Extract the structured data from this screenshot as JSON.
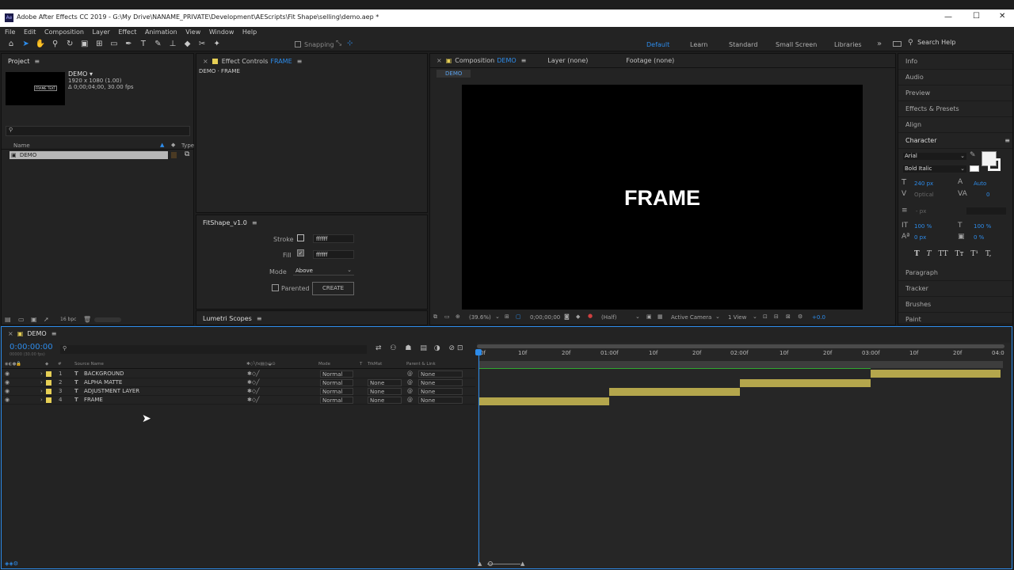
{
  "window": {
    "title": "Adobe After Effects CC 2019 - G:\\My Drive\\NANAME_PRIVATE\\Development\\AEScripts\\Fit Shape\\selling\\demo.aep *",
    "min": "—",
    "max": "☐",
    "close": "✕"
  },
  "menu": [
    "File",
    "Edit",
    "Composition",
    "Layer",
    "Effect",
    "Animation",
    "View",
    "Window",
    "Help"
  ],
  "toolbar": {
    "snapping": "Snapping",
    "workspaces": [
      "Default",
      "Learn",
      "Standard",
      "Small Screen",
      "Libraries"
    ],
    "more": "»",
    "search_placeholder": "Search Help"
  },
  "project": {
    "title": "Project",
    "item_name": "DEMO ▾",
    "item_info1": "1920 x 1080 (1.00)",
    "item_info2": "Δ 0;00;04;00, 30.00 fps",
    "thumb_text": "FRAME TEXT",
    "col_name": "Name",
    "col_type": "Type",
    "row_name": "DEMO",
    "bpc": "16 bpc"
  },
  "effect_controls": {
    "tab": "Effect Controls",
    "tab_target": "FRAME",
    "subtitle": "DEMO · FRAME"
  },
  "fitshape": {
    "title": "FitShape_v1.0",
    "stroke_label": "Stroke",
    "stroke_value": "ffffff",
    "fill_label": "Fill",
    "fill_value": "ffffff",
    "mode_label": "Mode",
    "mode_value": "Above",
    "parented_label": "Parented",
    "create_label": "CREATE"
  },
  "lumetri": {
    "title": "Lumetri Scopes"
  },
  "composition": {
    "tab": "Composition",
    "tab_target": "DEMO",
    "layer_tab": "Layer (none)",
    "footage_tab": "Footage (none)",
    "breadcrumb": "DEMO",
    "frame_text": "FRAME",
    "zoom": "(39.6%)",
    "timecode": "0;00;00;00",
    "resolution": "(Half)",
    "camera": "Active Camera",
    "view": "1 View",
    "exposure": "+0.0"
  },
  "right_panels": {
    "top": [
      "Info",
      "Audio",
      "Preview",
      "Effects & Presets",
      "Align"
    ],
    "character": "Character",
    "font": "Arial",
    "style": "Bold Italic",
    "size": "240 px",
    "leading": "Auto",
    "kerning": "Optical",
    "tracking": "0",
    "px": "- px",
    "vscale": "100 %",
    "hscale": "100 %",
    "baseline": "0 px",
    "tsume": "0 %",
    "style_buttons": [
      "T",
      "T",
      "TT",
      "Tт",
      "T¹",
      "T,"
    ],
    "bottom": [
      "Paragraph",
      "Tracker",
      "Brushes",
      "Paint"
    ]
  },
  "timeline": {
    "tab": "DEMO",
    "timecode": "0:00:00:00",
    "fps": "00000 (30.00 fps)",
    "search_placeholder": "",
    "col_num": "#",
    "col_source": "Source Name",
    "col_mode": "Mode",
    "col_t": "T",
    "col_trkmat": "TrkMat",
    "col_parent": "Parent & Link",
    "ruler": [
      "0f",
      "10f",
      "20f",
      "01:00f",
      "10f",
      "20f",
      "02:00f",
      "10f",
      "20f",
      "03:00f",
      "10f",
      "20f",
      "04:0"
    ],
    "layers": [
      {
        "num": "1",
        "name": "BACKGROUND",
        "mode": "Normal",
        "trkmat": "",
        "parent": "None"
      },
      {
        "num": "2",
        "name": "ALPHA MATTE",
        "mode": "Normal",
        "trkmat": "None",
        "parent": "None"
      },
      {
        "num": "3",
        "name": "ADJUSTMENT LAYER",
        "mode": "Normal",
        "trkmat": "None",
        "parent": "None"
      },
      {
        "num": "4",
        "name": "FRAME",
        "mode": "Normal",
        "trkmat": "None",
        "parent": "None"
      }
    ],
    "bar_color": "#b4a64c",
    "work_area_color": "#2fa82f"
  }
}
